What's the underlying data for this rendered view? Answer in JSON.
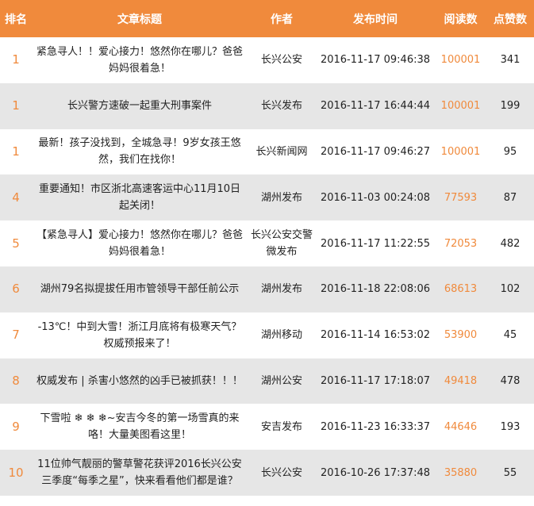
{
  "header": {
    "rank": "排名",
    "title": "文章标题",
    "author": "作者",
    "time": "发布时间",
    "reads": "阅读数",
    "likes": "点赞数"
  },
  "colors": {
    "accent": "#F08A3C",
    "row_alt": "#E6E6E6"
  },
  "rows": [
    {
      "rank": "1",
      "title": "紧急寻人！！爱心接力！悠然你在哪儿？爸爸妈妈很着急！",
      "author": "长兴公安",
      "time": "2016-11-17 09:46:38",
      "reads": "100001",
      "likes": "341"
    },
    {
      "rank": "1",
      "title": "长兴警方速破一起重大刑事案件",
      "author": "长兴发布",
      "time": "2016-11-17 16:44:44",
      "reads": "100001",
      "likes": "199"
    },
    {
      "rank": "1",
      "title": "最新！孩子没找到，全城急寻！9岁女孩王悠然，我们在找你！",
      "author": "长兴新闻网",
      "time": "2016-11-17 09:46:27",
      "reads": "100001",
      "likes": "95"
    },
    {
      "rank": "4",
      "title": "重要通知！市区浙北高速客运中心11月10日起关闭！",
      "author": "湖州发布",
      "time": "2016-11-03 00:24:08",
      "reads": "77593",
      "likes": "87"
    },
    {
      "rank": "5",
      "title": "【紧急寻人】爱心接力！悠然你在哪儿？爸爸妈妈很着急！",
      "author": "长兴公安交警微发布",
      "time": "2016-11-17 11:22:55",
      "reads": "72053",
      "likes": "482"
    },
    {
      "rank": "6",
      "title": "湖州79名拟提拔任用市管领导干部任前公示",
      "author": "湖州发布",
      "time": "2016-11-18 22:08:06",
      "reads": "68613",
      "likes": "102"
    },
    {
      "rank": "7",
      "title": "-13℃！中到大雪！浙江月底将有极寒天气？权威预报来了！",
      "author": "湖州移动",
      "time": "2016-11-14 16:53:02",
      "reads": "53900",
      "likes": "45"
    },
    {
      "rank": "8",
      "title": "权威发布 | 杀害小悠然的凶手已被抓获！！！",
      "author": "湖州公安",
      "time": "2016-11-17 17:18:07",
      "reads": "49418",
      "likes": "478"
    },
    {
      "rank": "9",
      "title": "下雪啦 ❄ ❄ ❄~安吉今冬的第一场雪真的来咯！大量美图看这里！",
      "author": "安吉发布",
      "time": "2016-11-23 16:33:37",
      "reads": "44646",
      "likes": "193"
    },
    {
      "rank": "10",
      "title": "11位帅气靓丽的警草警花获评2016长兴公安三季度“每季之星”，快来看看他们都是谁？",
      "author": "长兴公安",
      "time": "2016-10-26 17:37:48",
      "reads": "35880",
      "likes": "55"
    }
  ]
}
